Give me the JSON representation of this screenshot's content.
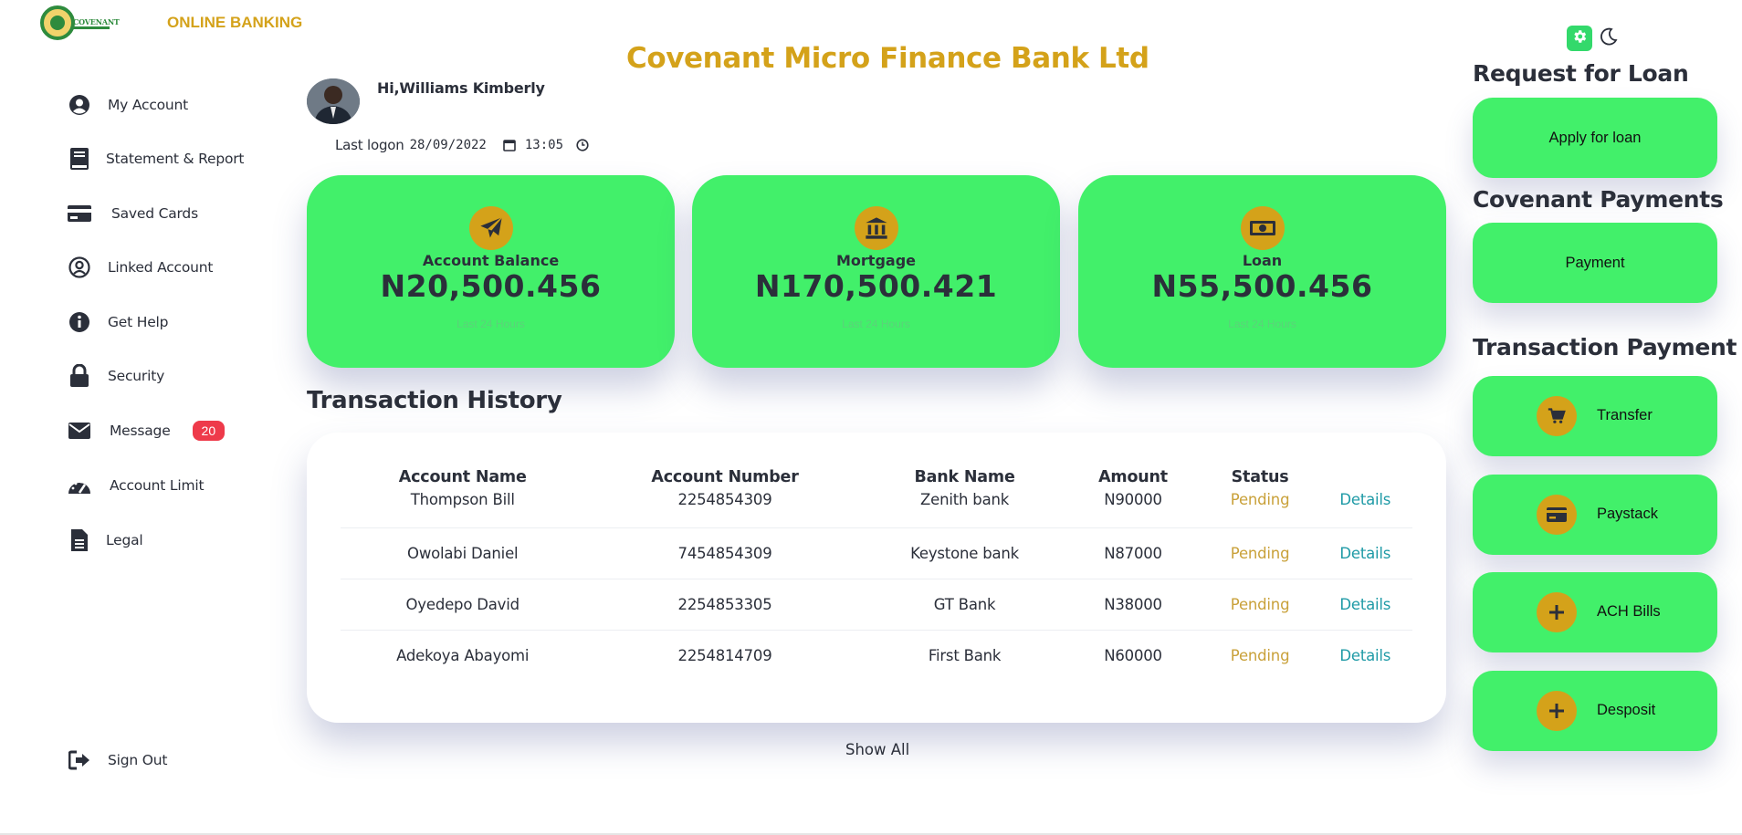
{
  "brand": {
    "logo_text": "COVENANT",
    "title": "ONLINE BANKING"
  },
  "header": {
    "bank_title": "Covenant Micro Finance Bank Ltd"
  },
  "theme": {
    "settings_icon": "gear-icon",
    "dark_mode_icon": "moon-icon",
    "accent": "#33d96b"
  },
  "user": {
    "greeting": "Hi,Williams Kimberly",
    "last_logon_label": "Last logon",
    "date": "28/09/2022",
    "time": "13:05"
  },
  "sidebar": {
    "items": [
      {
        "label": "My Account",
        "icon": "user-circle-icon"
      },
      {
        "label": "Statement & Report",
        "icon": "book-icon"
      },
      {
        "label": "Saved Cards",
        "icon": "credit-card-icon"
      },
      {
        "label": "Linked Account",
        "icon": "user-outline-icon"
      },
      {
        "label": "Get Help",
        "icon": "info-icon"
      },
      {
        "label": "Security",
        "icon": "lock-icon"
      },
      {
        "label": "Message",
        "icon": "envelope-icon",
        "badge": "20"
      },
      {
        "label": "Account Limit",
        "icon": "gauge-icon"
      },
      {
        "label": "Legal",
        "icon": "document-icon"
      }
    ],
    "sign_out": {
      "label": "Sign Out",
      "icon": "sign-out-icon"
    }
  },
  "cards": [
    {
      "label": "Account Balance",
      "value": "N20,500.456",
      "sub": "Last 24 Hours",
      "icon": "paper-plane-icon"
    },
    {
      "label": "Mortgage",
      "value": "N170,500.421",
      "sub": "Last 24 Hours",
      "icon": "bank-icon"
    },
    {
      "label": "Loan",
      "value": "N55,500.456",
      "sub": "Last 24 Hours",
      "icon": "money-bill-icon"
    }
  ],
  "transactions": {
    "title": "Transaction History",
    "columns": [
      "Account Name",
      "Account Number",
      "Bank Name",
      "Amount",
      "Status"
    ],
    "rows": [
      {
        "name": "Thompson Bill",
        "number": "2254854309",
        "bank": "Zenith bank",
        "amount": "N90000",
        "status": "Pending",
        "action": "Details"
      },
      {
        "name": "Owolabi Daniel",
        "number": "7454854309",
        "bank": "Keystone bank",
        "amount": "N87000",
        "status": "Pending",
        "action": "Details"
      },
      {
        "name": "Oyedepo David",
        "number": "2254853305",
        "bank": "GT Bank",
        "amount": "N38000",
        "status": "Pending",
        "action": "Details"
      },
      {
        "name": "Adekoya Abayomi",
        "number": "2254814709",
        "bank": "First Bank",
        "amount": "N60000",
        "status": "Pending",
        "action": "Details"
      }
    ],
    "show_all": "Show All"
  },
  "right_panel": {
    "loan_heading": "Request for Loan",
    "loan_button": "Apply for loan",
    "payments_heading": "Covenant Payments",
    "payment_button": "Payment",
    "transaction_heading": "Transaction Payment",
    "transaction_buttons": [
      {
        "label": "Transfer",
        "icon": "cart-icon"
      },
      {
        "label": "Paystack",
        "icon": "card-icon"
      },
      {
        "label": "ACH Bills",
        "icon": "plus-icon"
      },
      {
        "label": "Desposit",
        "icon": "plus-icon"
      }
    ]
  },
  "colors": {
    "brand_gold": "#d4a21a",
    "card_green": "#42f06a",
    "badge_red": "#ee3a4a",
    "link_teal": "#1e9aa6",
    "pending": "#c9a13a"
  }
}
